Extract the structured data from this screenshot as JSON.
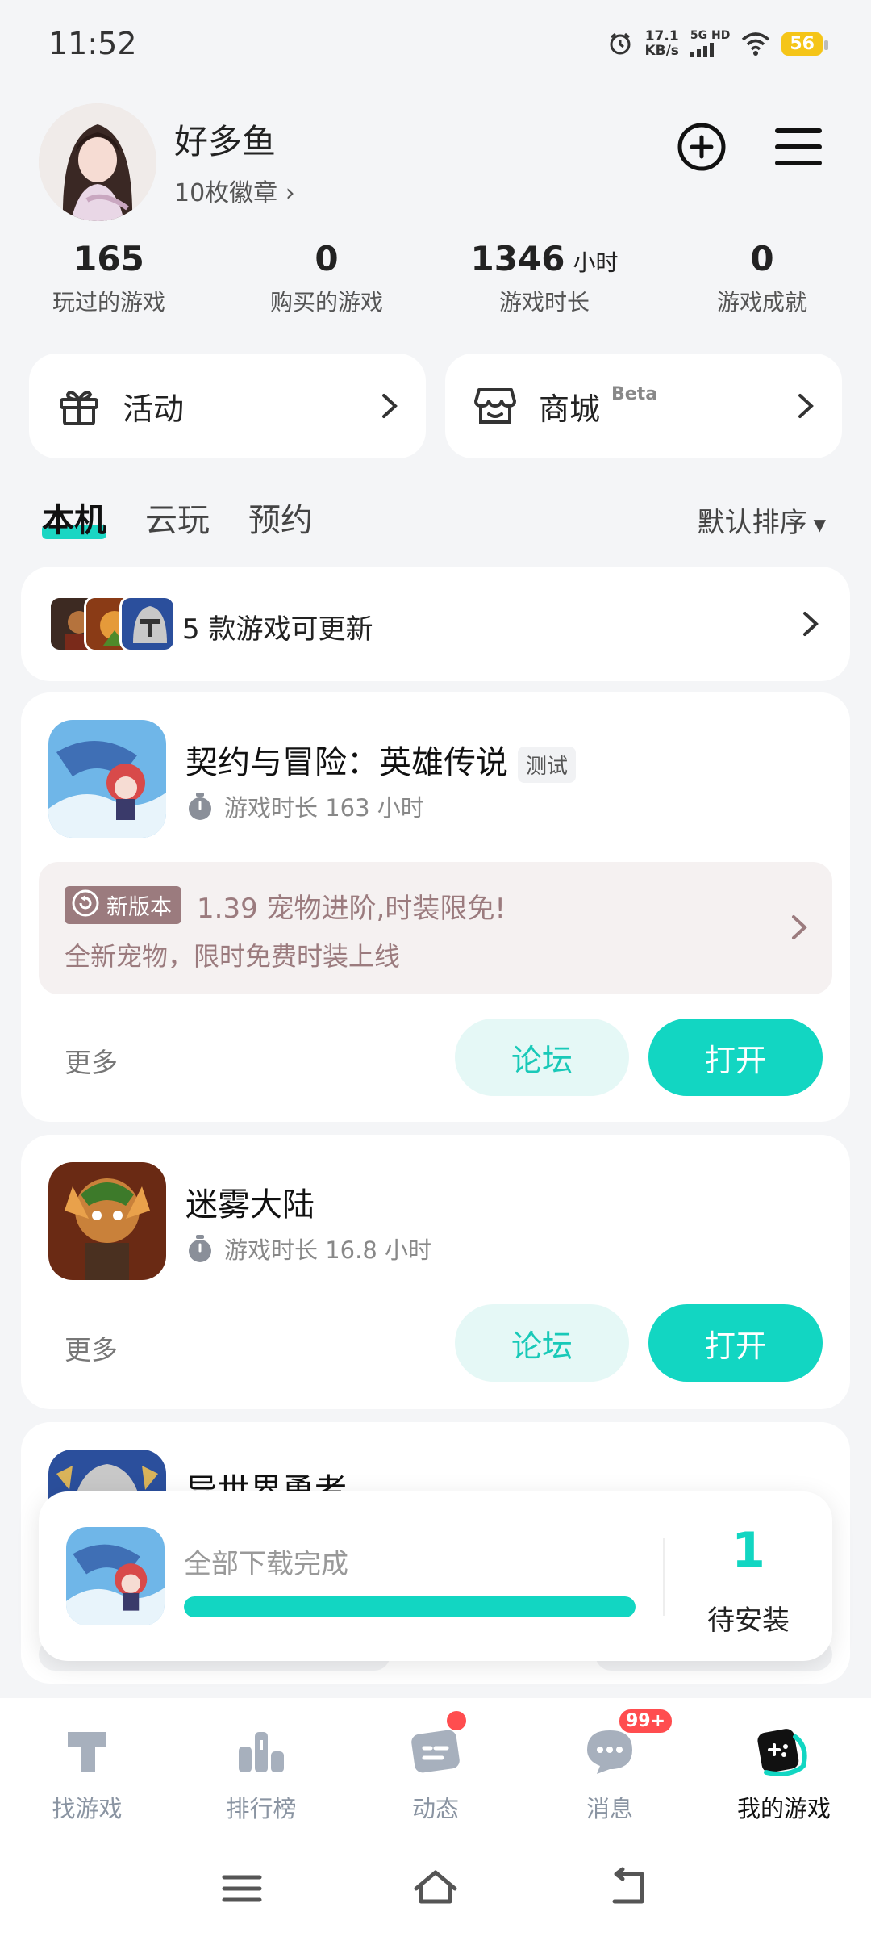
{
  "status_bar": {
    "time": "11:52",
    "net_speed_value": "17.1",
    "net_speed_unit": "KB/s",
    "network": "5G HD",
    "battery": "56"
  },
  "profile": {
    "username": "好多鱼",
    "badges_label": "10枚徽章 ›"
  },
  "stats": [
    {
      "value": "165",
      "unit": "",
      "label": "玩过的游戏"
    },
    {
      "value": "0",
      "unit": "",
      "label": "购买的游戏"
    },
    {
      "value": "1346",
      "unit": "小时",
      "label": "游戏时长"
    },
    {
      "value": "0",
      "unit": "",
      "label": "游戏成就"
    }
  ],
  "quick_links": {
    "activity": "活动",
    "store": "商城",
    "store_badge": "Beta"
  },
  "tabs": [
    {
      "label": "本机",
      "active": true
    },
    {
      "label": "云玩",
      "active": false
    },
    {
      "label": "预约",
      "active": false
    }
  ],
  "sort_label": "默认排序",
  "update_bar": {
    "text": "5 款游戏可更新"
  },
  "games": [
    {
      "title": "契约与冒险：英雄传说",
      "tag": "测试",
      "playtime": "游戏时长 163 小时",
      "news_badge": "新版本",
      "news_title": "1.39 宠物进阶,时装限免!",
      "news_sub": "全新宠物，限时免费时装上线",
      "more": "更多",
      "forum": "论坛",
      "open": "打开"
    },
    {
      "title": "迷雾大陆",
      "playtime": "游戏时长 16.8 小时",
      "more": "更多",
      "forum": "论坛",
      "open": "打开"
    },
    {
      "title": "异世界勇者"
    }
  ],
  "download_panel": {
    "text": "全部下载完成",
    "progress": 1.0,
    "count": "1",
    "count_label": "待安装"
  },
  "bottom_nav": [
    {
      "label": "找游戏",
      "icon": "find-games-icon"
    },
    {
      "label": "排行榜",
      "icon": "leaderboard-icon"
    },
    {
      "label": "动态",
      "icon": "feed-icon"
    },
    {
      "label": "消息",
      "icon": "messages-icon",
      "badge": "99+"
    },
    {
      "label": "我的游戏",
      "icon": "my-games-icon",
      "active": true
    }
  ],
  "colors": {
    "accent": "#12d6c2",
    "accent_light": "#e5f8f6",
    "news": "#9b7b7e",
    "badge_red": "#ff4d4f",
    "battery": "#f5c518"
  }
}
